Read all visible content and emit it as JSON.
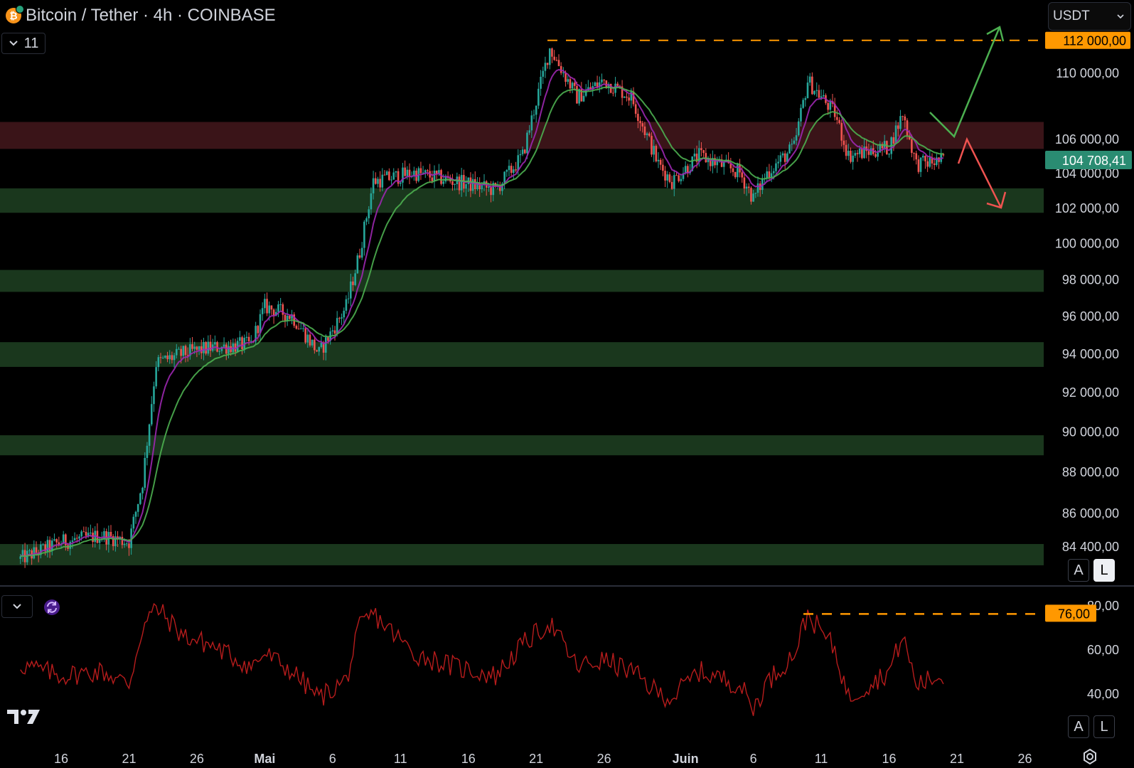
{
  "header": {
    "title": "Bitcoin / Tether · 4h · COINBASE",
    "coin_symbol": "₿",
    "indicator_count": "11",
    "currency": "USDT"
  },
  "buttons": {
    "auto_label": "A",
    "log_label": "L"
  },
  "colors": {
    "background": "#000000",
    "up_candle": "#26a69a",
    "down_candle": "#ef5350",
    "ema_fast": "#9c27b0",
    "ema_slow": "#4caf50",
    "resistance_zone": "#3d1519",
    "support_zone": "#1b3a1f",
    "marker_line": "#ff9800",
    "rsi_line": "#b71c1c",
    "arrow_up": "#4caf50",
    "arrow_down": "#ef5350",
    "last_price_bg": "#2a8c72"
  },
  "chart_data": [
    {
      "type": "candlestick",
      "series": [
        {
          "name": "BTC/USDT"
        },
        {
          "name": "EMA fast"
        },
        {
          "name": "EMA slow"
        }
      ],
      "x_ticks": [
        "16",
        "21",
        "26",
        "Mai",
        "6",
        "11",
        "16",
        "21",
        "26",
        "Juin",
        "6",
        "11",
        "16",
        "21",
        "26"
      ],
      "y_ticks": [
        "110 000,00",
        "106 000,00",
        "104 000,00",
        "102 000,00",
        "100 000,00",
        "98 000,00",
        "96 000,00",
        "94 000,00",
        "92 000,00",
        "90 000,00",
        "88 000,00",
        "86 000,00",
        "84 400,00"
      ],
      "y_scale": "log",
      "ylim": [
        83200,
        113500
      ],
      "price_anchors": [
        {
          "date": "Apr 13",
          "price": 83800
        },
        {
          "date": "Apr 16",
          "price": 84600
        },
        {
          "date": "Apr 19",
          "price": 84900
        },
        {
          "date": "Apr 21",
          "price": 84600
        },
        {
          "date": "Apr 22",
          "price": 87500
        },
        {
          "date": "Apr 23",
          "price": 93500
        },
        {
          "date": "Apr 25",
          "price": 94000
        },
        {
          "date": "Apr 27",
          "price": 94300
        },
        {
          "date": "Apr 30",
          "price": 94500
        },
        {
          "date": "May 1",
          "price": 96500
        },
        {
          "date": "May 3",
          "price": 96000
        },
        {
          "date": "May 5",
          "price": 94000
        },
        {
          "date": "May 7",
          "price": 96500
        },
        {
          "date": "May 8",
          "price": 99500
        },
        {
          "date": "May 9",
          "price": 103500
        },
        {
          "date": "May 12",
          "price": 104000
        },
        {
          "date": "May 15",
          "price": 103500
        },
        {
          "date": "May 18",
          "price": 103000
        },
        {
          "date": "May 20",
          "price": 105000
        },
        {
          "date": "May 22",
          "price": 111500
        },
        {
          "date": "May 24",
          "price": 108500
        },
        {
          "date": "May 26",
          "price": 109500
        },
        {
          "date": "May 28",
          "price": 108500
        },
        {
          "date": "May 30",
          "price": 104500
        },
        {
          "date": "May 31",
          "price": 103500
        },
        {
          "date": "Jun 2",
          "price": 105000
        },
        {
          "date": "Jun 5",
          "price": 104000
        },
        {
          "date": "Jun 6",
          "price": 102500
        },
        {
          "date": "Jun 7",
          "price": 104000
        },
        {
          "date": "Jun 9",
          "price": 105500
        },
        {
          "date": "Jun 10",
          "price": 109500
        },
        {
          "date": "Jun 12",
          "price": 107500
        },
        {
          "date": "Jun 13",
          "price": 105000
        },
        {
          "date": "Jun 16",
          "price": 105500
        },
        {
          "date": "Jun 17",
          "price": 107500
        },
        {
          "date": "Jun 18",
          "price": 104500
        },
        {
          "date": "Jun 20",
          "price": 104708
        }
      ],
      "zones": [
        {
          "kind": "resistance",
          "from": 105400,
          "to": 107000
        },
        {
          "kind": "support",
          "from": 101700,
          "to": 103100
        },
        {
          "kind": "support",
          "from": 97300,
          "to": 98500
        },
        {
          "kind": "support",
          "from": 93300,
          "to": 94600
        },
        {
          "kind": "support",
          "from": 88800,
          "to": 89800
        },
        {
          "kind": "support",
          "from": 83500,
          "to": 84500
        }
      ],
      "price_markers": [
        {
          "label": "112 000,00",
          "value": 112000,
          "style": "orange-dashed"
        },
        {
          "label": "104 708,41",
          "value": 104708.41,
          "style": "last-price"
        }
      ],
      "scenarios": [
        {
          "direction": "up",
          "target": "112 000,00"
        },
        {
          "direction": "down",
          "target": "102 000,00"
        }
      ],
      "grid": false,
      "legend": "none"
    },
    {
      "type": "line",
      "series": [
        {
          "name": "RSI"
        }
      ],
      "y_ticks": [
        "80,00",
        "60,00",
        "40,00"
      ],
      "ylim": [
        26,
        82
      ],
      "rsi_anchors": [
        {
          "date": "Apr 13",
          "value": 53
        },
        {
          "date": "Apr 16",
          "value": 48
        },
        {
          "date": "Apr 19",
          "value": 50
        },
        {
          "date": "Apr 21",
          "value": 44
        },
        {
          "date": "Apr 22",
          "value": 70
        },
        {
          "date": "Apr 23",
          "value": 79
        },
        {
          "date": "Apr 25",
          "value": 66
        },
        {
          "date": "Apr 27",
          "value": 62
        },
        {
          "date": "Apr 30",
          "value": 52
        },
        {
          "date": "May 1",
          "value": 58
        },
        {
          "date": "May 3",
          "value": 50
        },
        {
          "date": "May 5",
          "value": 38
        },
        {
          "date": "May 7",
          "value": 46
        },
        {
          "date": "May 8",
          "value": 70
        },
        {
          "date": "May 9",
          "value": 76
        },
        {
          "date": "May 12",
          "value": 58
        },
        {
          "date": "May 15",
          "value": 52
        },
        {
          "date": "May 18",
          "value": 48
        },
        {
          "date": "May 20",
          "value": 62
        },
        {
          "date": "May 22",
          "value": 72
        },
        {
          "date": "May 24",
          "value": 52
        },
        {
          "date": "May 26",
          "value": 55
        },
        {
          "date": "May 28",
          "value": 50
        },
        {
          "date": "May 30",
          "value": 40
        },
        {
          "date": "May 31",
          "value": 38
        },
        {
          "date": "Jun 2",
          "value": 50
        },
        {
          "date": "Jun 5",
          "value": 44
        },
        {
          "date": "Jun 6",
          "value": 33
        },
        {
          "date": "Jun 7",
          "value": 45
        },
        {
          "date": "Jun 9",
          "value": 58
        },
        {
          "date": "Jun 10",
          "value": 76
        },
        {
          "date": "Jun 12",
          "value": 60
        },
        {
          "date": "Jun 13",
          "value": 38
        },
        {
          "date": "Jun 16",
          "value": 50
        },
        {
          "date": "Jun 17",
          "value": 66
        },
        {
          "date": "Jun 18",
          "value": 44
        },
        {
          "date": "Jun 20",
          "value": 48
        }
      ],
      "markers": [
        {
          "label": "76,00",
          "value": 76,
          "style": "orange-dashed"
        }
      ]
    }
  ]
}
